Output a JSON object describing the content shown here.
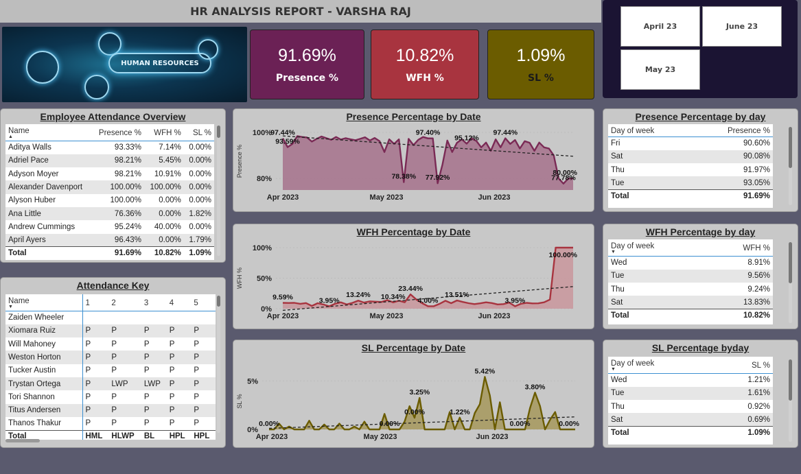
{
  "header": {
    "title": "HR ANALYSIS REPORT - VARSHA RAJ"
  },
  "hero": {
    "label": "HUMAN RESOURCES"
  },
  "kpis": [
    {
      "value": "91.69%",
      "label": "Presence %",
      "color": "#6b2155"
    },
    {
      "value": "10.82%",
      "label": "WFH %",
      "color": "#a8343f"
    },
    {
      "value": "1.09%",
      "label": "SL %",
      "color": "#6b5c00"
    }
  ],
  "month_slicer": [
    "April 23",
    "June 23",
    "May 23"
  ],
  "attendance_overview": {
    "title": "Employee Attendance Overview",
    "columns": [
      "Name",
      "Presence %",
      "WFH %",
      "SL %"
    ],
    "rows": [
      [
        "Aditya Walls",
        "93.33%",
        "7.14%",
        "0.00%"
      ],
      [
        "Adriel Pace",
        "98.21%",
        "5.45%",
        "0.00%"
      ],
      [
        "Adyson Moyer",
        "98.21%",
        "10.91%",
        "0.00%"
      ],
      [
        "Alexander Davenport",
        "100.00%",
        "100.00%",
        "0.00%"
      ],
      [
        "Alyson Huber",
        "100.00%",
        "0.00%",
        "0.00%"
      ],
      [
        "Ana Little",
        "76.36%",
        "0.00%",
        "1.82%"
      ],
      [
        "Andrew Cummings",
        "95.24%",
        "40.00%",
        "0.00%"
      ],
      [
        "April Ayers",
        "96.43%",
        "0.00%",
        "1.79%"
      ]
    ],
    "total": [
      "Total",
      "91.69%",
      "10.82%",
      "1.09%"
    ]
  },
  "attendance_key": {
    "title": "Attendance Key",
    "columns": [
      "Name",
      "1",
      "2",
      "3",
      "4",
      "5"
    ],
    "rows": [
      [
        "Zaiden Wheeler",
        "",
        "",
        "",
        "",
        ""
      ],
      [
        "Xiomara Ruiz",
        "P",
        "P",
        "P",
        "P",
        "P"
      ],
      [
        "Will Mahoney",
        "P",
        "P",
        "P",
        "P",
        "P"
      ],
      [
        "Weston Horton",
        "P",
        "P",
        "P",
        "P",
        "P"
      ],
      [
        "Tucker Austin",
        "P",
        "P",
        "P",
        "P",
        "P"
      ],
      [
        "Trystan Ortega",
        "P",
        "LWP",
        "LWP",
        "P",
        "P"
      ],
      [
        "Tori Shannon",
        "P",
        "P",
        "P",
        "P",
        "P"
      ],
      [
        "Titus Andersen",
        "P",
        "P",
        "P",
        "P",
        "P"
      ],
      [
        "Thanos Thakur",
        "P",
        "P",
        "P",
        "P",
        "P"
      ]
    ],
    "total": [
      "Total",
      "HML",
      "HLWP",
      "BL",
      "HPL",
      "HPL"
    ]
  },
  "presence_by_day": {
    "title": "Presence Percentage by day",
    "columns": [
      "Day of week",
      "Presence %"
    ],
    "rows": [
      [
        "Fri",
        "90.60%"
      ],
      [
        "Sat",
        "90.08%"
      ],
      [
        "Thu",
        "91.97%"
      ],
      [
        "Tue",
        "93.05%"
      ]
    ],
    "total": [
      "Total",
      "91.69%"
    ]
  },
  "wfh_by_day": {
    "title": "WFH Percentage by day",
    "columns": [
      "Day of week",
      "WFH %"
    ],
    "rows": [
      [
        "Wed",
        "8.91%"
      ],
      [
        "Tue",
        "9.56%"
      ],
      [
        "Thu",
        "9.24%"
      ],
      [
        "Sat",
        "13.83%"
      ]
    ],
    "total": [
      "Total",
      "10.82%"
    ]
  },
  "sl_by_day": {
    "title": "SL Percentage byday",
    "columns": [
      "Day of week",
      "SL %"
    ],
    "rows": [
      [
        "Wed",
        "1.21%"
      ],
      [
        "Tue",
        "1.61%"
      ],
      [
        "Thu",
        "0.92%"
      ],
      [
        "Sat",
        "0.69%"
      ]
    ],
    "total": [
      "Total",
      "1.09%"
    ]
  },
  "chart_data": [
    {
      "type": "area",
      "title": "Presence Percentage by Date",
      "ylabel": "Presence %",
      "xlabel": "",
      "x_ticks": [
        "Apr 2023",
        "May 2023",
        "Jun 2023"
      ],
      "y_ticks": [
        "100%",
        "80%"
      ],
      "ylim": [
        75,
        100
      ],
      "color": "#7a2a55",
      "fill": "#a7778f",
      "trend": true,
      "values": [
        97.44,
        93.59,
        95,
        98.4,
        98,
        97.8,
        96,
        97.2,
        98.2,
        97.5,
        96.8,
        98,
        96.9,
        97.5,
        97,
        96.6,
        97.2,
        97.9,
        96.5,
        97.6,
        96.2,
        91.5,
        97,
        95,
        97,
        78.38,
        97.2,
        94.5,
        96.8,
        98,
        97.4,
        97.4,
        77.92,
        86,
        96.5,
        91.5,
        95.5,
        97,
        95.1,
        97.4,
        96.3,
        93.5,
        95.6,
        92,
        97,
        93.5,
        97.44,
        95,
        96.7,
        93,
        96.2,
        95.5,
        92,
        95.6,
        93.5,
        93,
        90,
        80,
        77.78,
        80,
        80
      ],
      "labels": [
        {
          "i": 0,
          "text": "97.44%"
        },
        {
          "i": 1,
          "text": "93.59%"
        },
        {
          "i": 25,
          "text": "78.38%"
        },
        {
          "i": 30,
          "text": "97.40%"
        },
        {
          "i": 32,
          "text": "77.92%"
        },
        {
          "i": 38,
          "text": "95.12%"
        },
        {
          "i": 46,
          "text": "97.44%"
        },
        {
          "i": 58,
          "text": "77.78%"
        },
        {
          "i": 60,
          "text": "80.00%"
        }
      ]
    },
    {
      "type": "area",
      "title": "WFH Percentage by Date",
      "ylabel": "WFH %",
      "xlabel": "",
      "x_ticks": [
        "Apr 2023",
        "May 2023",
        "Jun 2023"
      ],
      "y_ticks": [
        "100%",
        "50%",
        "0%"
      ],
      "ylim": [
        0,
        100
      ],
      "color": "#a8343f",
      "fill": "#c9999e",
      "trend": true,
      "values": [
        9.59,
        9.3,
        9.6,
        8,
        9.2,
        4.5,
        9,
        6.8,
        3.95,
        8,
        10.5,
        7,
        9.5,
        13.24,
        10,
        12,
        11.5,
        11,
        14,
        10.34,
        13,
        10.5,
        23.44,
        15,
        9,
        4,
        4,
        8,
        13,
        9,
        13.51,
        11,
        9,
        7.5,
        8.8,
        10.5,
        9.2,
        7,
        7.5,
        10,
        3.95,
        8,
        9.5,
        8.6,
        8.8,
        10.5,
        15,
        100,
        100,
        100,
        100
      ],
      "labels": [
        {
          "i": 0,
          "text": "9.59%"
        },
        {
          "i": 8,
          "text": "3.95%"
        },
        {
          "i": 13,
          "text": "13.24%"
        },
        {
          "i": 19,
          "text": "10.34%"
        },
        {
          "i": 22,
          "text": "23.44%"
        },
        {
          "i": 25,
          "text": "4.00%"
        },
        {
          "i": 30,
          "text": "13.51%"
        },
        {
          "i": 40,
          "text": "3.95%"
        },
        {
          "i": 50,
          "text": "100.00%"
        }
      ]
    },
    {
      "type": "area",
      "title": "SL Percentage by Date",
      "ylabel": "SL %",
      "xlabel": "",
      "x_ticks": [
        "Apr 2023",
        "May 2023",
        "Jun 2023"
      ],
      "y_ticks": [
        "5%",
        "0%"
      ],
      "ylim": [
        0,
        5.8
      ],
      "color": "#6b5c00",
      "fill": "#a79a62",
      "trend": true,
      "values": [
        0,
        0,
        0.6,
        0,
        0.3,
        0,
        0,
        0,
        0.9,
        0,
        0,
        0.5,
        0,
        0,
        0.6,
        0,
        0,
        0.3,
        0,
        0.8,
        0,
        0,
        0,
        1.6,
        0,
        0,
        0,
        0.8,
        2.4,
        1.2,
        3.25,
        0,
        0,
        0,
        0,
        0,
        1.8,
        0,
        1.22,
        0,
        0,
        1.7,
        2.6,
        5.42,
        3.5,
        0,
        2.8,
        0,
        0,
        0,
        0,
        0,
        2.2,
        3.8,
        2.4,
        0,
        1,
        1.8,
        0,
        0,
        0,
        0
      ],
      "labels": [
        {
          "i": 0,
          "text": "0.00%"
        },
        {
          "i": 30,
          "text": "3.25%"
        },
        {
          "i": 24,
          "text": "0.00%"
        },
        {
          "i": 29,
          "text": "0.00%"
        },
        {
          "i": 38,
          "text": "1.22%"
        },
        {
          "i": 43,
          "text": "5.42%"
        },
        {
          "i": 50,
          "text": "0.00%"
        },
        {
          "i": 53,
          "text": "3.80%"
        },
        {
          "i": 61,
          "text": "0.00%"
        }
      ]
    }
  ]
}
